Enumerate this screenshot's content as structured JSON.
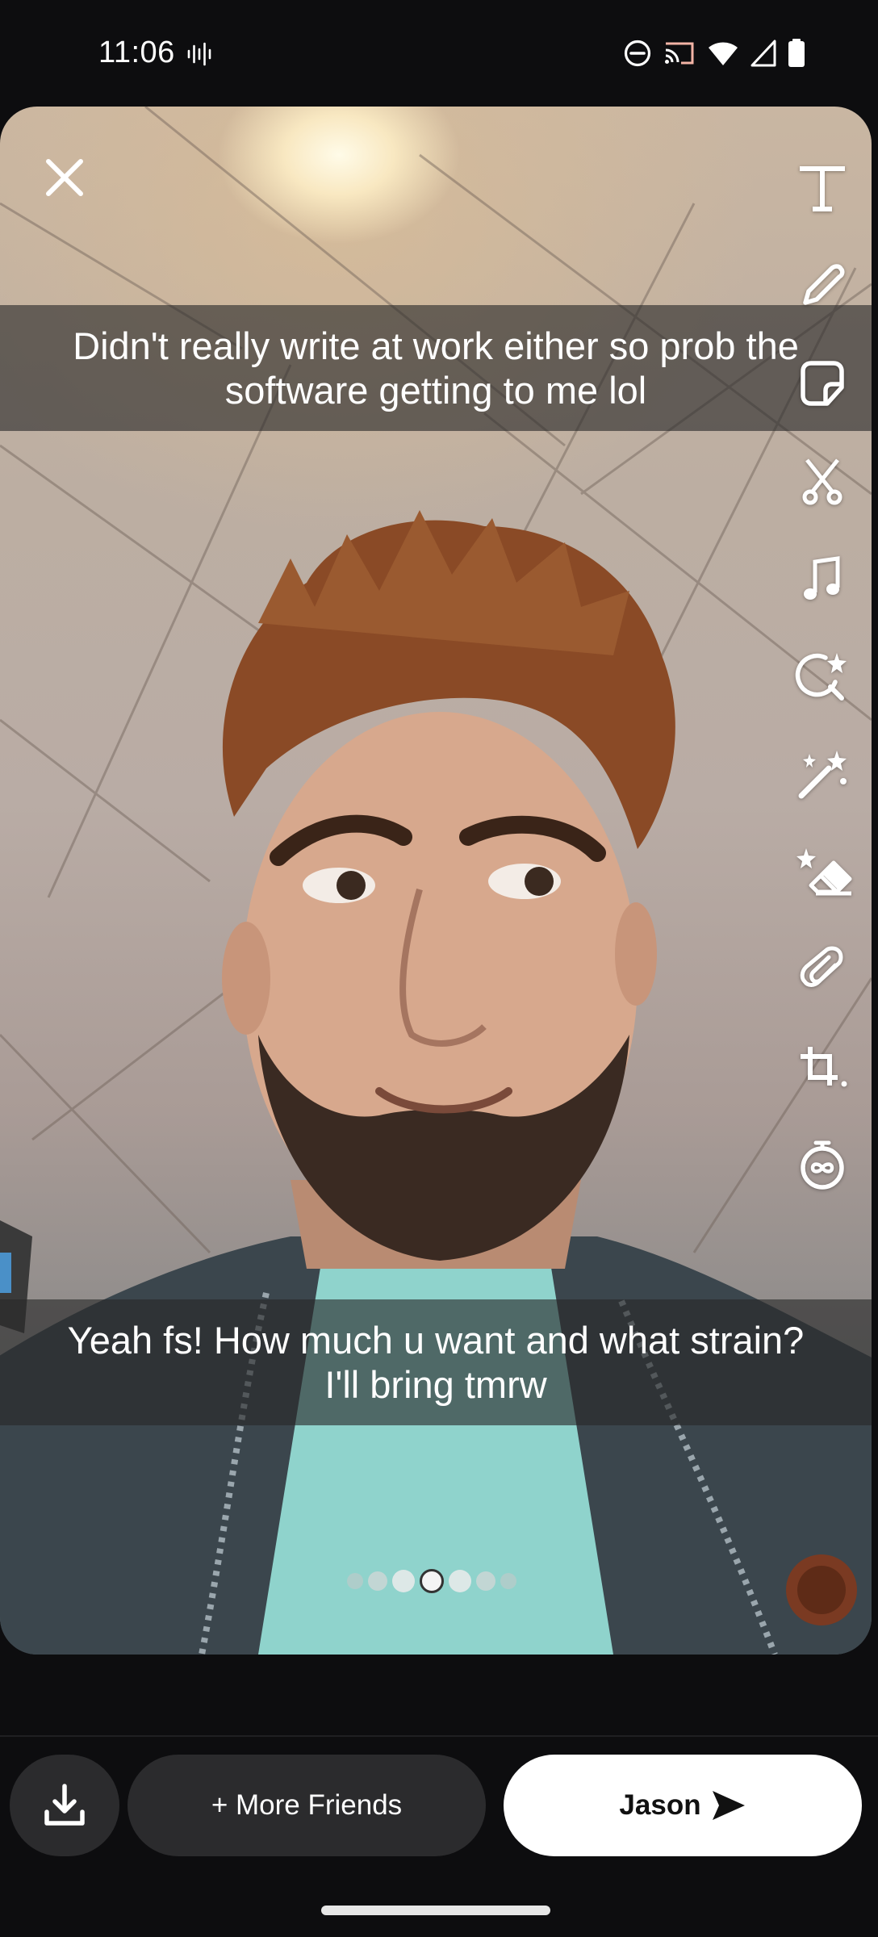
{
  "status_bar": {
    "time": "11:06",
    "left_icon": "voice-waveform-icon",
    "right_icons": [
      "do-not-disturb-icon",
      "cast-icon",
      "wifi-icon",
      "cell-signal-icon",
      "battery-icon"
    ]
  },
  "snap": {
    "captions": {
      "top": [
        "Didn't really write at work either so prob the",
        "software getting to me lol"
      ],
      "bottom": [
        "Yeah fs! How much u want and what strain?",
        "I'll bring tmrw"
      ]
    },
    "close_icon": "close-icon",
    "tools": [
      {
        "name": "text",
        "icon": "text-icon"
      },
      {
        "name": "draw",
        "icon": "pencil-icon"
      },
      {
        "name": "sticker",
        "icon": "sticker-icon"
      },
      {
        "name": "scissors",
        "icon": "scissors-icon"
      },
      {
        "name": "music",
        "icon": "music-note-icon"
      },
      {
        "name": "lens",
        "icon": "lens-search-icon"
      },
      {
        "name": "magic",
        "icon": "magic-wand-icon"
      },
      {
        "name": "eraser",
        "icon": "magic-eraser-icon"
      },
      {
        "name": "attachment",
        "icon": "paperclip-icon"
      },
      {
        "name": "crop",
        "icon": "crop-icon"
      },
      {
        "name": "timer",
        "icon": "timer-icon"
      }
    ],
    "page_dots": {
      "count": 7,
      "active_index": 3
    }
  },
  "bottom_bar": {
    "download_icon": "download-icon",
    "more_friends_label": "+ More Friends",
    "send_label": "Jason",
    "send_icon": "send-arrow-icon"
  },
  "colors": {
    "background": "#0d0d0f",
    "button_dark": "#2b2b2d",
    "button_light": "#ffffff"
  }
}
